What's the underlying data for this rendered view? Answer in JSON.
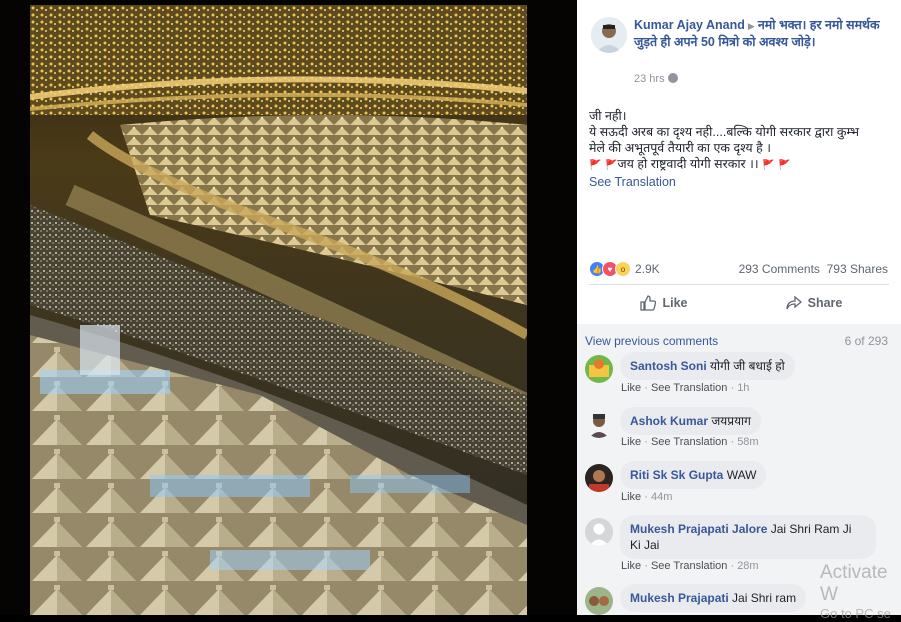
{
  "post": {
    "author": "Kumar Ajay Anand",
    "group": "नमो भक्त। हर नमो समर्थक जुड़ते ही अपने 50 मित्रो को अवश्य जोड़े।",
    "timestamp": "23 hrs",
    "text_lines": [
      "जी नही।",
      "ये सऊदी अरब का दृश्य नही....बल्कि योगी सरकार द्वारा कुम्भ",
      "मेले की अभूतपूर्व तैयारी का एक दृश्य है ।",
      "जय हो राष्ट्रवादी योगी सरकार ।।"
    ],
    "see_translation": "See Translation",
    "reaction_count": "2.9K",
    "comments_count": "293 Comments",
    "shares_count": "793 Shares",
    "like_label": "Like",
    "share_label": "Share"
  },
  "comments_section": {
    "view_previous": "View previous comments",
    "pager": "6 of 293",
    "comments": [
      {
        "name": "Santosh Soni",
        "text": "योगी जी बधाई हो",
        "like": "Like",
        "translate": "See Translation",
        "time": "1h"
      },
      {
        "name": "Ashok Kumar",
        "text": "जयप्रयाग",
        "like": "Like",
        "translate": "See Translation",
        "time": "58m"
      },
      {
        "name": "Riti Sk Sk Gupta",
        "text": "WAW",
        "like": "Like",
        "translate": "",
        "time": "44m"
      },
      {
        "name": "Mukesh Prajapati Jalore",
        "text_line1": "Jai Shri Ram Ji",
        "text_line2": "Ki Jai",
        "like": "Like",
        "translate": "See Translation",
        "time": "28m"
      },
      {
        "name": "Mukesh Prajapati",
        "text": "Jai Shri ram"
      }
    ]
  },
  "watermark": {
    "line1": "Activate W",
    "line2": "Go to PC se"
  },
  "colors": {
    "link": "#365899",
    "muted": "#90949c",
    "bubble": "#e9ebee",
    "photo_glow": "#e8c66a"
  }
}
